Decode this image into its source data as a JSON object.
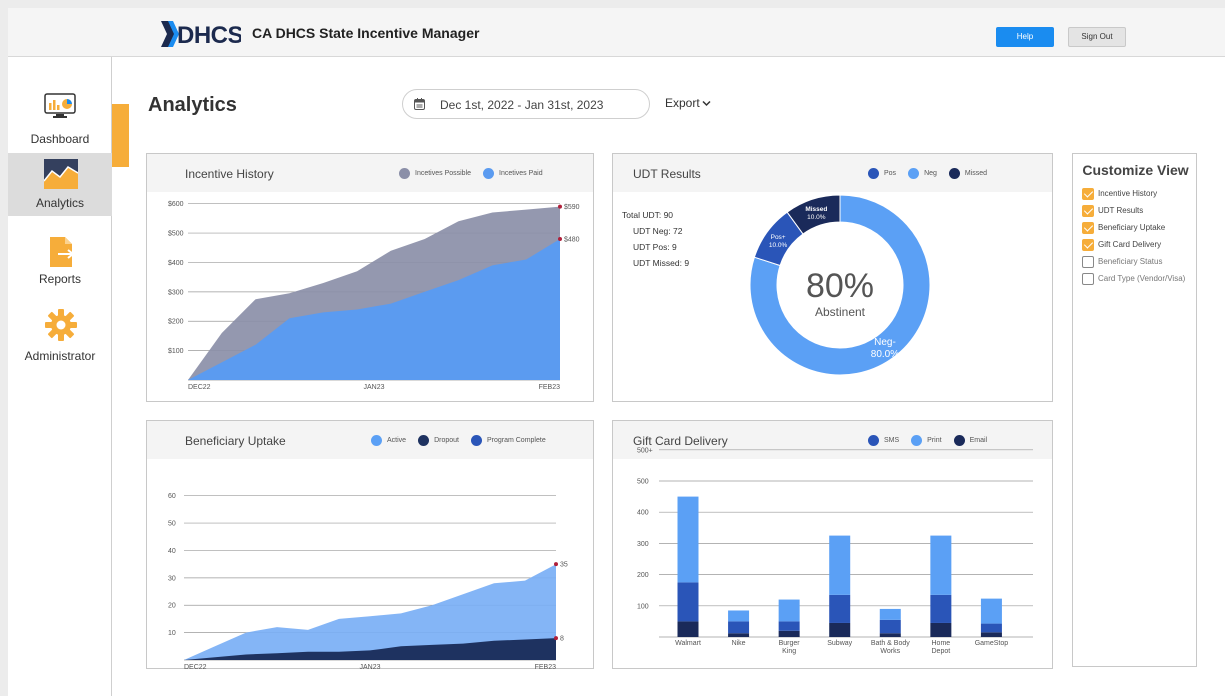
{
  "header": {
    "title": "CA DHCS State Incentive Manager",
    "logo_text": "DHCS",
    "help_label": "Help",
    "signout_label": "Sign Out",
    "colors": {
      "primary": "#1a8cf0",
      "accent": "#f6ad3a"
    }
  },
  "sidebar": {
    "items": [
      {
        "label": "Dashboard",
        "icon": "monitor-chart-icon",
        "active": false
      },
      {
        "label": "Analytics",
        "icon": "area-chart-icon",
        "active": true
      },
      {
        "label": "Reports",
        "icon": "file-export-icon",
        "active": false
      },
      {
        "label": "Administrator",
        "icon": "gear-icon",
        "active": false
      }
    ]
  },
  "main": {
    "title": "Analytics",
    "date_range": "Dec 1st, 2022 - Jan 31st, 2023",
    "export_label": "Export"
  },
  "panels": {
    "incentive": {
      "title": "Incentive History",
      "legend": [
        {
          "label": "Incetives Possible",
          "color": "#8b8fa8"
        },
        {
          "label": "Incetives Paid",
          "color": "#5b9bf0"
        }
      ]
    },
    "udt": {
      "title": "UDT Results",
      "legend": [
        {
          "label": "Pos",
          "color": "#2a55b8"
        },
        {
          "label": "Neg",
          "color": "#5ba0f5"
        },
        {
          "label": "Missed",
          "color": "#1a2a5a"
        }
      ],
      "stats": {
        "total": "Total UDT: 90",
        "neg": "UDT Neg: 72",
        "pos": "UDT Pos: 9",
        "missed": "UDT Missed: 9"
      },
      "center_value": "80%",
      "center_label": "Abstinent"
    },
    "uptake": {
      "title": "Beneficiary Uptake",
      "legend": [
        {
          "label": "Active",
          "color": "#5ba0f5"
        },
        {
          "label": "Dropout",
          "color": "#1e3260"
        },
        {
          "label": "Program Complete",
          "color": "#2a55b8"
        }
      ]
    },
    "giftcard": {
      "title": "Gift Card Delivery",
      "legend": [
        {
          "label": "SMS",
          "color": "#2a55b8"
        },
        {
          "label": "Print",
          "color": "#5ba0f5"
        },
        {
          "label": "Email",
          "color": "#1a2a5a"
        }
      ]
    }
  },
  "customize": {
    "title": "Customize View",
    "items": [
      {
        "label": "Incentive History",
        "checked": true
      },
      {
        "label": "UDT Results",
        "checked": true
      },
      {
        "label": "Beneficiary Uptake",
        "checked": true
      },
      {
        "label": "Gift Card Delivery",
        "checked": true
      },
      {
        "label": "Beneficiary Status",
        "checked": false
      },
      {
        "label": "Card Type (Vendor/Visa)",
        "checked": false
      }
    ]
  },
  "chart_data": [
    {
      "id": "incentive",
      "type": "area",
      "title": "Incentive History",
      "x_ticks": [
        "DEC22",
        "JAN23",
        "FEB23"
      ],
      "x": [
        0,
        1,
        2,
        3,
        4,
        5,
        6,
        7,
        8,
        9,
        10,
        11
      ],
      "y_ticks": [
        "$100",
        "$200",
        "$300",
        "$400",
        "$500",
        "$600"
      ],
      "ylim": [
        0,
        650
      ],
      "series": [
        {
          "name": "Incetives Possible",
          "color": "#8b8fa8",
          "values": [
            0,
            160,
            275,
            295,
            330,
            370,
            440,
            480,
            540,
            570,
            580,
            590
          ]
        },
        {
          "name": "Incetives Paid",
          "color": "#5b9bf0",
          "values": [
            0,
            60,
            120,
            210,
            230,
            240,
            260,
            300,
            340,
            390,
            410,
            480
          ]
        }
      ],
      "end_labels": [
        "$590",
        "$480"
      ]
    },
    {
      "id": "udt",
      "type": "pie",
      "title": "UDT Results",
      "slices": [
        {
          "name": "Neg-",
          "value": 80.0,
          "label": "80.0%",
          "color": "#5ba0f5"
        },
        {
          "name": "Pos+",
          "value": 10.0,
          "label": "10.0%",
          "color": "#2a55b8"
        },
        {
          "name": "Missed",
          "value": 10.0,
          "label": "10.0%",
          "color": "#1a2a5a"
        }
      ]
    },
    {
      "id": "uptake",
      "type": "area",
      "title": "Beneficiary Uptake",
      "x_ticks": [
        "DEC22",
        "JAN23",
        "FEB23"
      ],
      "x": [
        0,
        1,
        2,
        3,
        4,
        5,
        6,
        7,
        8,
        9,
        10,
        11,
        12
      ],
      "y_ticks": [
        "10",
        "20",
        "30",
        "40",
        "50",
        "60"
      ],
      "ylim": [
        0,
        65
      ],
      "series": [
        {
          "name": "Active",
          "color": "#7aaff5",
          "values": [
            0,
            5,
            10,
            12,
            11,
            15,
            16,
            17,
            20,
            24,
            28,
            29,
            35
          ]
        },
        {
          "name": "Dropout",
          "color": "#1e3260",
          "values": [
            0,
            1,
            2,
            2.5,
            3,
            3,
            3.5,
            5,
            5.5,
            6,
            7,
            7.5,
            8
          ]
        }
      ],
      "end_labels": [
        "35",
        "8"
      ]
    },
    {
      "id": "giftcard",
      "type": "bar",
      "title": "Gift Card Delivery",
      "categories": [
        "Walmart",
        "Nike",
        "Burger King",
        "Subway",
        "Bath & Body Works",
        "Home Depot",
        "GameStop"
      ],
      "category_lines": [
        [
          "Walmart"
        ],
        [
          "Nike"
        ],
        [
          "Burger",
          "King"
        ],
        [
          "Subway"
        ],
        [
          "Bath & Body",
          "Works"
        ],
        [
          "Home",
          "Depot"
        ],
        [
          "GameStop"
        ]
      ],
      "y_ticks": [
        "100",
        "200",
        "300",
        "400",
        "500",
        "500+"
      ],
      "ylim": [
        0,
        600
      ],
      "series": [
        {
          "name": "Email",
          "color": "#1a2a5a",
          "values": [
            50,
            12,
            20,
            45,
            12,
            45,
            15
          ]
        },
        {
          "name": "SMS",
          "color": "#2a55b8",
          "values": [
            125,
            38,
            30,
            90,
            43,
            90,
            28
          ]
        },
        {
          "name": "Print",
          "color": "#5ba0f5",
          "values": [
            275,
            35,
            70,
            190,
            35,
            190,
            80
          ]
        }
      ]
    }
  ]
}
